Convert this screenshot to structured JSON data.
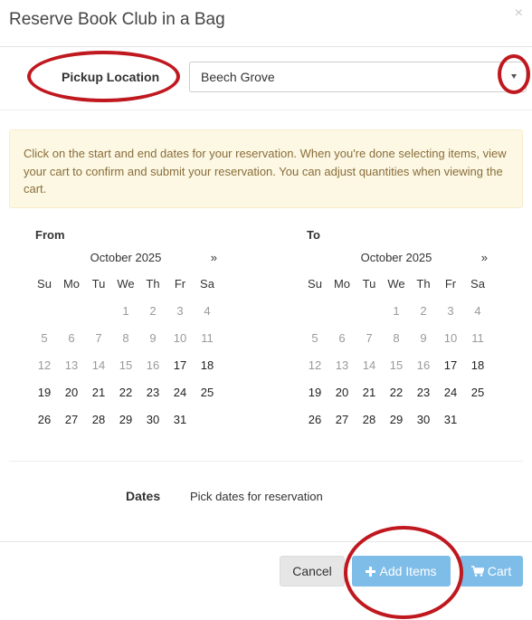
{
  "modal": {
    "title": "Reserve Book Club in a Bag",
    "close": "×"
  },
  "pickup": {
    "label": "Pickup Location",
    "value": "Beech Grove"
  },
  "info": {
    "text": "Click on the start and end dates for your reservation. When you're done selecting items, view your cart to confirm and submit your reservation. You can adjust quantities when viewing the cart."
  },
  "from_cal": {
    "label": "From",
    "month": "October 2025",
    "next": "»"
  },
  "to_cal": {
    "label": "To",
    "month": "October 2025",
    "next": "»"
  },
  "weekdays": [
    "Su",
    "Mo",
    "Tu",
    "We",
    "Th",
    "Fr",
    "Sa"
  ],
  "weeks": [
    [
      "",
      "",
      "",
      "1",
      "2",
      "3",
      "4"
    ],
    [
      "5",
      "6",
      "7",
      "8",
      "9",
      "10",
      "11"
    ],
    [
      "12",
      "13",
      "14",
      "15",
      "16",
      "17",
      "18"
    ],
    [
      "19",
      "20",
      "21",
      "22",
      "23",
      "24",
      "25"
    ],
    [
      "26",
      "27",
      "28",
      "29",
      "30",
      "31",
      ""
    ]
  ],
  "first_selectable_day": 17,
  "dates": {
    "label": "Dates",
    "value": "Pick dates for reservation"
  },
  "buttons": {
    "cancel": "Cancel",
    "add_items": "Add Items",
    "cart": "Cart"
  },
  "colors": {
    "accent": "#7fbde9",
    "annotation": "#c0181f",
    "alert_bg": "#fcf8e3",
    "alert_text": "#8a6d3b"
  }
}
